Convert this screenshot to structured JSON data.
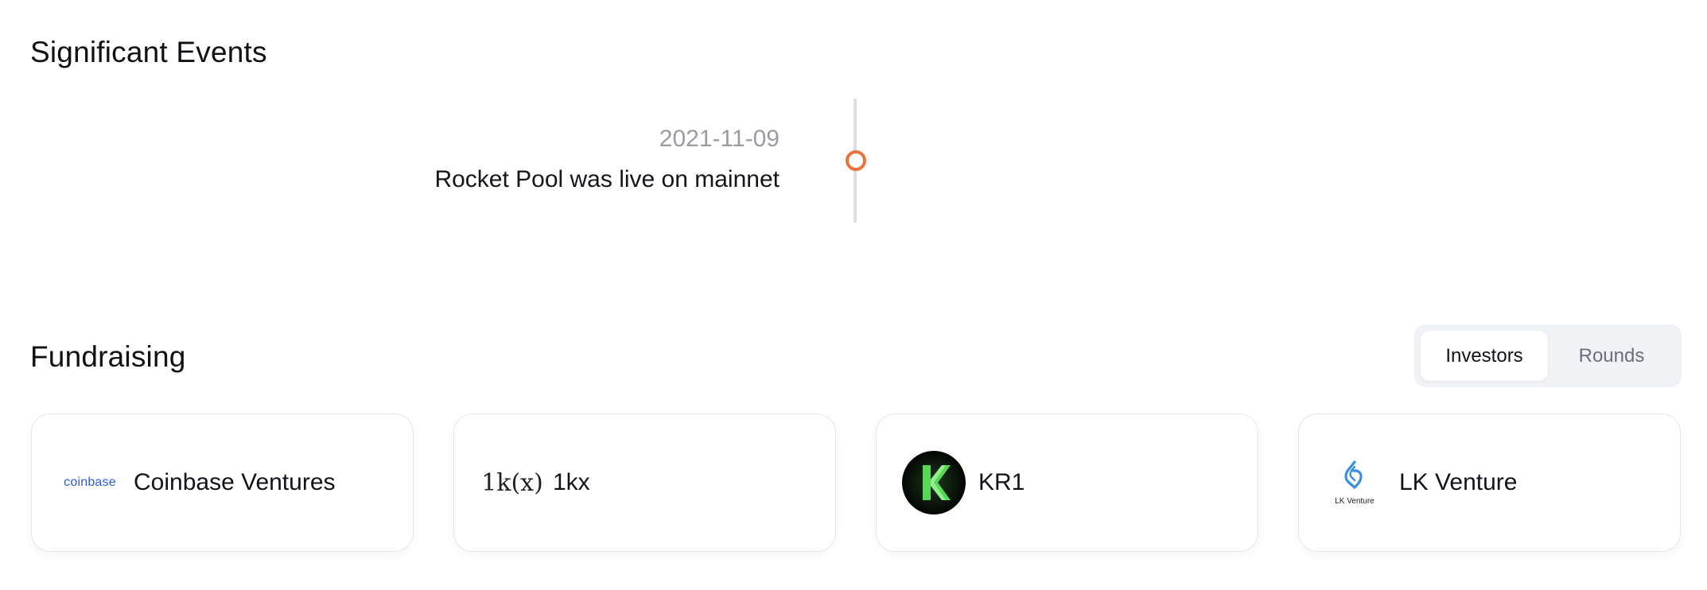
{
  "events": {
    "title": "Significant Events",
    "items": [
      {
        "date": "2021-11-09",
        "text": "Rocket Pool was live on mainnet"
      }
    ],
    "accent_color": "#e8743b"
  },
  "fundraising": {
    "title": "Fundraising",
    "tabs": [
      {
        "label": "Investors",
        "active": true
      },
      {
        "label": "Rounds",
        "active": false
      }
    ],
    "investors": [
      {
        "name": "Coinbase Ventures",
        "logo_text": "coinbase",
        "logo_icon": "coinbase-logo"
      },
      {
        "name": "1kx",
        "logo_text": "1k(x)",
        "logo_icon": "1kx-logo"
      },
      {
        "name": "KR1",
        "logo_icon": "kr1-logo"
      },
      {
        "name": "LK Venture",
        "logo_text": "LK Venture",
        "logo_icon": "lk-venture-logo"
      }
    ]
  }
}
